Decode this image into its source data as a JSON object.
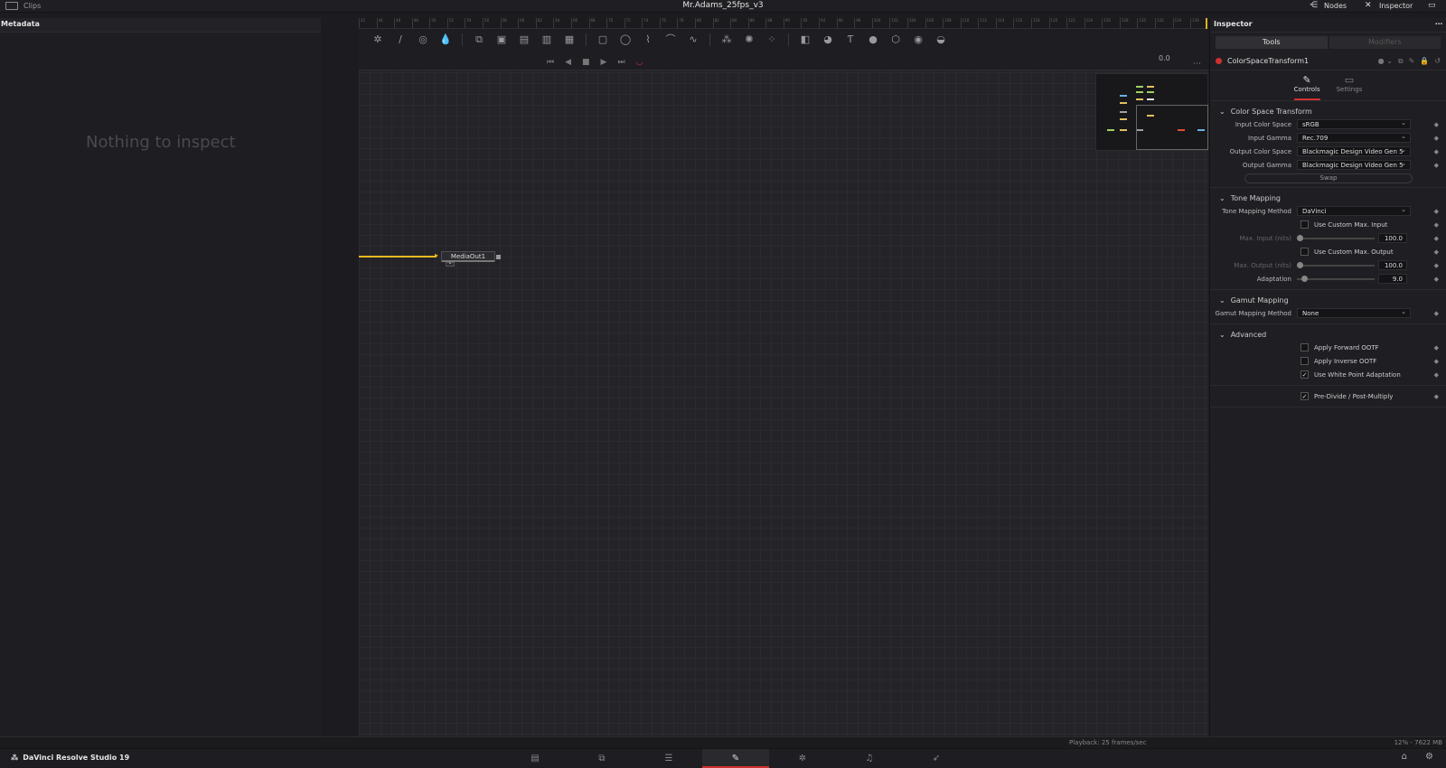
{
  "topbar": {
    "clips_label": "Clips",
    "project_title": "Mr.Adams_25fps_v3",
    "nodes_label": "Nodes",
    "inspector_label": "Inspector"
  },
  "left_panel": {
    "header": "Metadata",
    "empty_message": "Nothing to inspect"
  },
  "node_editor": {
    "ruler_ticks": [
      "42",
      "44",
      "46",
      "48",
      "50",
      "52",
      "54",
      "56",
      "58",
      "60",
      "62",
      "64",
      "66",
      "68",
      "70",
      "72",
      "74",
      "76",
      "78",
      "80",
      "82",
      "84",
      "86",
      "88",
      "90",
      "92",
      "94",
      "96",
      "98",
      "100",
      "102",
      "104",
      "106",
      "108",
      "110",
      "112",
      "114",
      "116",
      "118",
      "120",
      "122",
      "124",
      "126",
      "128",
      "130",
      "132",
      "134",
      "136"
    ],
    "timecode": "0.0",
    "node_name": "MediaOut1"
  },
  "inspector": {
    "header": "Inspector",
    "tabs": {
      "tools": "Tools",
      "modifiers": "Modifiers"
    },
    "tool_name": "ColorSpaceTransform1",
    "subtabs": {
      "controls": "Controls",
      "settings": "Settings"
    },
    "sections": {
      "cst": "Color Space Transform",
      "tone": "Tone Mapping",
      "gamut": "Gamut Mapping",
      "advanced": "Advanced"
    },
    "fields": {
      "input_color_space_label": "Input Color Space",
      "input_color_space": "sRGB",
      "input_gamma_label": "Input Gamma",
      "input_gamma": "Rec.709",
      "output_color_space_label": "Output Color Space",
      "output_color_space": "Blackmagic Design Video Gen 5",
      "output_gamma_label": "Output Gamma",
      "output_gamma": "Blackmagic Design Video Gen 5",
      "swap": "Swap",
      "tone_method_label": "Tone Mapping Method",
      "tone_method": "DaVinci",
      "use_custom_max_input": "Use Custom Max. Input",
      "max_input_label": "Max. Input (nits)",
      "max_input": "100.0",
      "use_custom_max_output": "Use Custom Max. Output",
      "max_output_label": "Max. Output (nits)",
      "max_output": "100.0",
      "adaptation_label": "Adaptation",
      "adaptation": "9.0",
      "gamut_method_label": "Gamut Mapping Method",
      "gamut_method": "None",
      "apply_forward_ootf": "Apply Forward OOTF",
      "apply_inverse_ootf": "Apply Inverse OOTF",
      "use_white_point": "Use White Point Adaptation",
      "predivide": "Pre-Divide / Post-Multiply"
    },
    "checked": {
      "use_white_point": "✓",
      "predivide": "✓"
    }
  },
  "status": {
    "playback": "Playback: 25 frames/sec",
    "memory": "12% - 7622 MB"
  },
  "pagebar": {
    "brand": "DaVinci Resolve Studio 19"
  }
}
